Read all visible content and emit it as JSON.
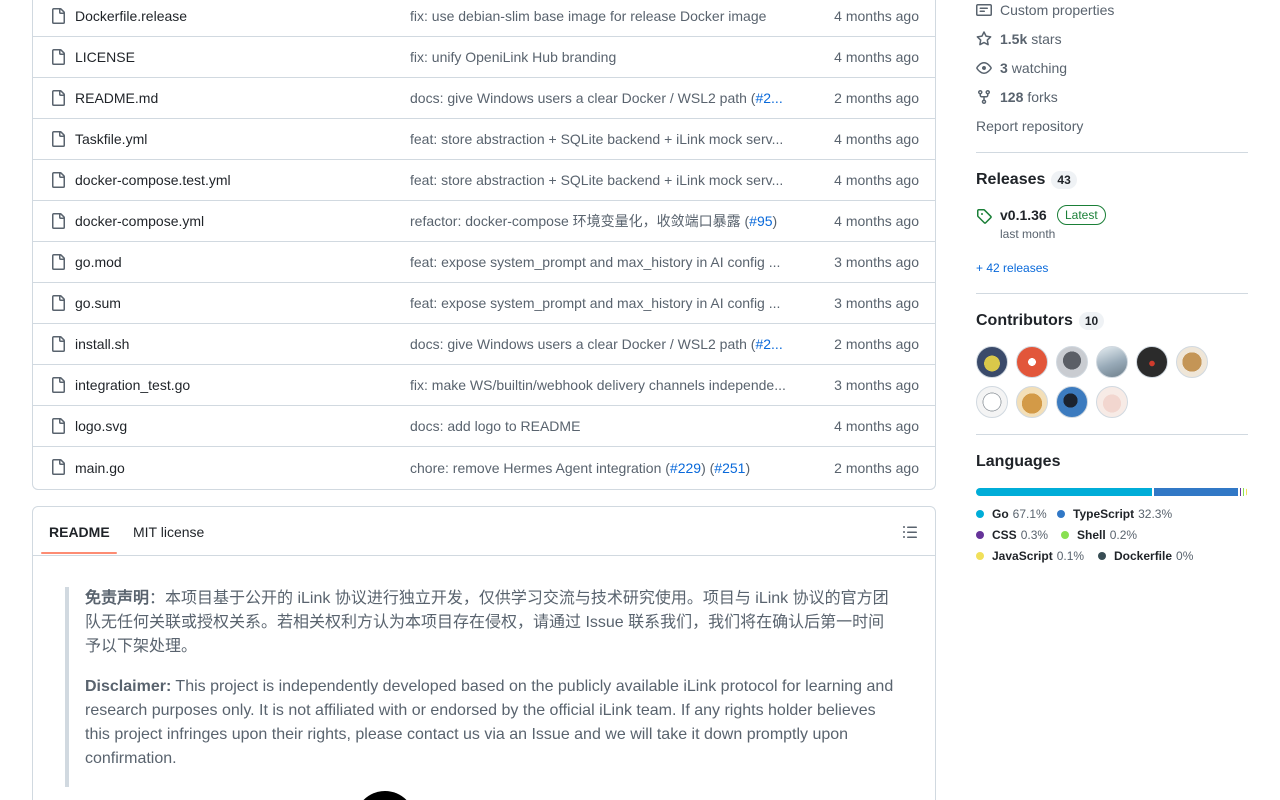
{
  "files": [
    {
      "name": "Dockerfile.release",
      "message": "fix: use debian-slim base image for release Docker image",
      "time": "4 months ago"
    },
    {
      "name": "LICENSE",
      "message": "fix: unify OpeniLink Hub branding",
      "time": "4 months ago"
    },
    {
      "name": "README.md",
      "message": "docs: give Windows users a clear Docker / WSL2 path (",
      "link": "#2...",
      "time": "2 months ago"
    },
    {
      "name": "Taskfile.yml",
      "message": "feat: store abstraction + SQLite backend + iLink mock serv...",
      "time": "4 months ago"
    },
    {
      "name": "docker-compose.test.yml",
      "message": "feat: store abstraction + SQLite backend + iLink mock serv...",
      "time": "4 months ago"
    },
    {
      "name": "docker-compose.yml",
      "message": "refactor: docker-compose 环境变量化，收敛端口暴露 (",
      "link": "#95",
      "suffix": ")",
      "time": "4 months ago"
    },
    {
      "name": "go.mod",
      "message": "feat: expose system_prompt and max_history in AI config ...",
      "time": "3 months ago"
    },
    {
      "name": "go.sum",
      "message": "feat: expose system_prompt and max_history in AI config ...",
      "time": "3 months ago"
    },
    {
      "name": "install.sh",
      "message": "docs: give Windows users a clear Docker / WSL2 path (",
      "link": "#2...",
      "time": "2 months ago"
    },
    {
      "name": "integration_test.go",
      "message": "fix: make WS/builtin/webhook delivery channels independe...",
      "time": "3 months ago"
    },
    {
      "name": "logo.svg",
      "message": "docs: add logo to README",
      "time": "4 months ago"
    },
    {
      "name": "main.go",
      "message": "chore: remove Hermes Agent integration (",
      "link": "#229",
      "mid": ") (",
      "link2": "#251",
      "suffix": ")",
      "time": "2 months ago"
    }
  ],
  "readme": {
    "tabs": [
      "README",
      "MIT license"
    ],
    "cn_strong": "免责声明",
    "cn_text": "：本项目基于公开的 iLink 协议进行独立开发，仅供学习交流与技术研究使用。项目与 iLink 协议的官方团队无任何关联或授权关系。若相关权利方认为本项目存在侵权，请通过 Issue 联系我们，我们将在确认后第一时间予以下架处理。",
    "en_strong": "Disclaimer:",
    "en_text": " This project is independently developed based on the publicly available iLink protocol for learning and research purposes only. It is not affiliated with or endorsed by the official iLink team. If any rights holder believes this project infringes upon their rights, please contact us via an Issue and we will take it down promptly upon confirmation."
  },
  "sidebar": {
    "custom_properties": "Custom properties",
    "stars_count": "1.5k",
    "stars_label": "stars",
    "watching_count": "3",
    "watching_label": "watching",
    "forks_count": "128",
    "forks_label": "forks",
    "report": "Report repository",
    "releases_title": "Releases",
    "releases_count": "43",
    "latest_release": "v0.1.36",
    "latest_badge": "Latest",
    "latest_date": "last month",
    "more_releases": "+ 42 releases",
    "contributors_title": "Contributors",
    "contributors_count": "10",
    "languages_title": "Languages",
    "languages": [
      {
        "name": "Go",
        "percent": "67.1%",
        "value": 67.1,
        "color": "#00ADD8"
      },
      {
        "name": "TypeScript",
        "percent": "32.3%",
        "value": 32.3,
        "color": "#3178c6"
      },
      {
        "name": "CSS",
        "percent": "0.3%",
        "value": 0.3,
        "color": "#663399"
      },
      {
        "name": "Shell",
        "percent": "0.2%",
        "value": 0.2,
        "color": "#89e051"
      },
      {
        "name": "JavaScript",
        "percent": "0.1%",
        "value": 0.1,
        "color": "#f1e05a"
      },
      {
        "name": "Dockerfile",
        "percent": "0%",
        "value": 0.05,
        "color": "#384d54"
      }
    ]
  }
}
